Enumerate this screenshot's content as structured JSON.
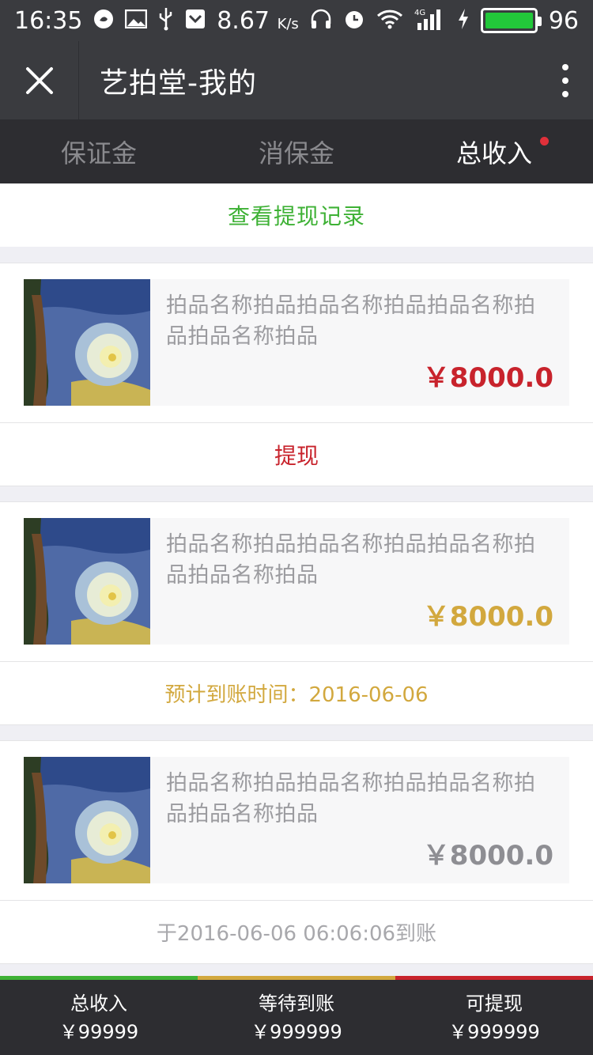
{
  "status_bar": {
    "time": "16:35",
    "speed": "8.67",
    "speed_unit": "K/s",
    "network": "4G",
    "battery": "96",
    "icons_left": [
      "weibo-icon",
      "image-icon",
      "usb-icon",
      "download-icon"
    ],
    "icons_right": [
      "headphones-icon",
      "alarm-icon",
      "wifi-icon",
      "signal-icon",
      "charging-icon",
      "battery-icon"
    ]
  },
  "header": {
    "title": "艺拍堂-我的",
    "close_icon": "close-icon",
    "more_icon": "more-vertical-icon"
  },
  "tabs": [
    {
      "label": "保证金",
      "active": false
    },
    {
      "label": "消保金",
      "active": false
    },
    {
      "label": "总收入",
      "active": true,
      "has_dot": true
    }
  ],
  "record_link": "查看提现记录",
  "items": [
    {
      "name": "拍品名称拍品拍品名称拍品拍品名称拍品拍品名称拍品",
      "price": "￥8000.0",
      "price_color": "#c8232c",
      "action": "提现"
    },
    {
      "name": "拍品名称拍品拍品名称拍品拍品名称拍品拍品名称拍品",
      "price": "￥8000.0",
      "price_color": "#d2a83e",
      "action": "预计到账时间：2016-06-06"
    },
    {
      "name": "拍品名称拍品拍品名称拍品拍品名称拍品拍品名称拍品",
      "price": "￥8000.0",
      "price_color": "#8e8e93",
      "action": "于2016-06-06 06:06:06到账"
    }
  ],
  "bottom_bar": [
    {
      "label": "总收入",
      "value": "￥99999",
      "stripe_color": "#3eb135"
    },
    {
      "label": "等待到账",
      "value": "￥999999",
      "stripe_color": "#d2a83e"
    },
    {
      "label": "可提现",
      "value": "￥999999",
      "stripe_color": "#c8232c"
    }
  ],
  "colors": {
    "header_bg": "#3a3b3f",
    "tabs_bg": "#2d2d31",
    "accent_green": "#3eb135",
    "accent_red": "#c8232c",
    "accent_gold": "#d2a83e"
  }
}
